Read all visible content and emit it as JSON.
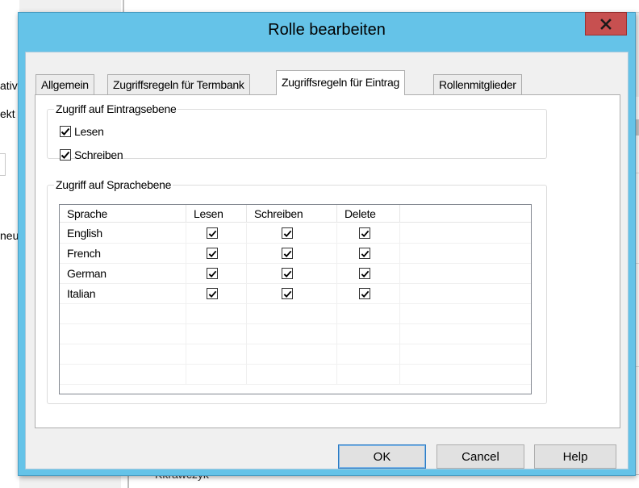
{
  "background": {
    "left_fragments": [
      "ativ",
      "ekt",
      "neu"
    ],
    "bottom_fragment": "Kkrawczyk"
  },
  "dialog": {
    "title": "Rolle bearbeiten",
    "close_icon": "close-x-icon"
  },
  "tabs": [
    {
      "label": "Allgemein",
      "active": false
    },
    {
      "label": "Zugriffsregeln für Termbank",
      "active": false
    },
    {
      "label": "Zugriffsregeln für Eintrag",
      "active": true
    },
    {
      "label": "Rollenmitglieder",
      "active": false
    }
  ],
  "entry_level": {
    "legend": "Zugriff auf Eintragsebene",
    "read_label": "Lesen",
    "read_checked": true,
    "write_label": "Schreiben",
    "write_checked": true
  },
  "language_level": {
    "legend": "Zugriff auf Sprachebene",
    "columns": [
      "Sprache",
      "Lesen",
      "Schreiben",
      "Delete"
    ],
    "rows": [
      {
        "language": "English",
        "read": true,
        "write": true,
        "delete": true
      },
      {
        "language": "French",
        "read": true,
        "write": true,
        "delete": true
      },
      {
        "language": "German",
        "read": true,
        "write": true,
        "delete": true
      },
      {
        "language": "Italian",
        "read": true,
        "write": true,
        "delete": true
      }
    ]
  },
  "buttons": {
    "ok": "OK",
    "cancel": "Cancel",
    "help": "Help"
  },
  "colors": {
    "title_bar": "#65c3e8",
    "close_button": "#c75050",
    "default_button_border": "#2b7bc4"
  }
}
